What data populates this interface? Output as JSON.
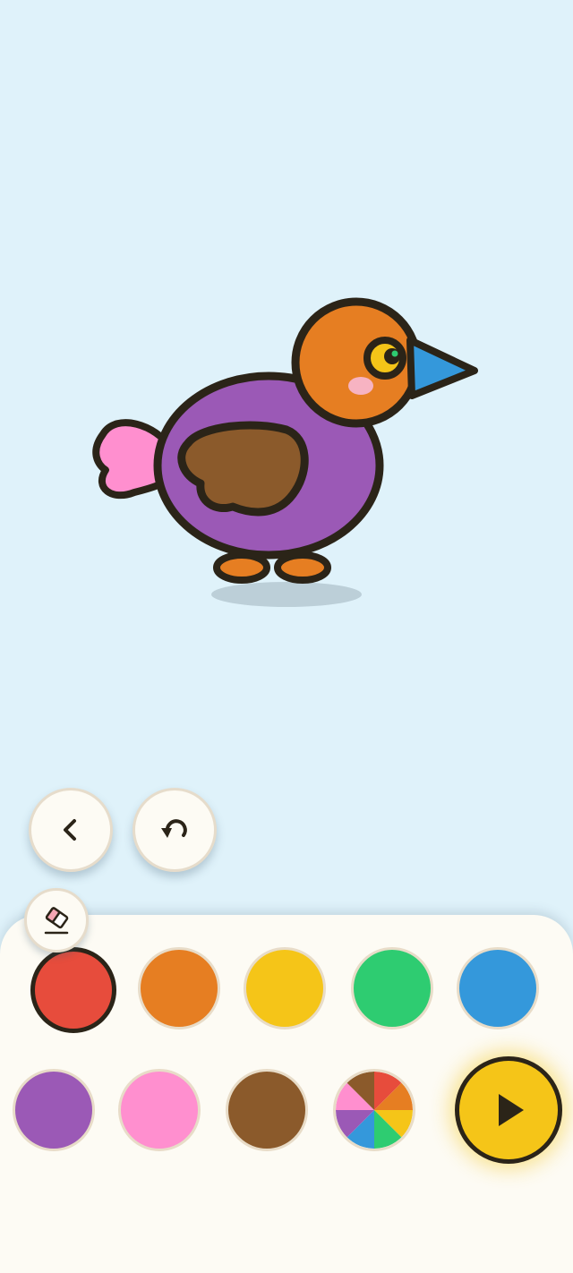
{
  "app": {
    "screen": "coloring-canvas"
  },
  "drawing": {
    "subject": "bird",
    "fills": {
      "body": "#9b59b6",
      "head": "#e67e22",
      "wing": "#8b5a2b",
      "tail": "#ff8fcf",
      "beak": "#3498db",
      "feet": "#e67e22",
      "eye": "#f5c518",
      "cheek": "#f7b3c2",
      "outline": "#2b2418",
      "shadow": "#bccfd8"
    }
  },
  "toolbar": {
    "back_icon": "chevron-left-icon",
    "undo_icon": "undo-icon",
    "eraser_icon": "eraser-icon"
  },
  "palette": {
    "selected_index": 0,
    "colors": [
      {
        "name": "red",
        "hex": "#e74c3c"
      },
      {
        "name": "orange",
        "hex": "#e67e22"
      },
      {
        "name": "yellow",
        "hex": "#f5c518"
      },
      {
        "name": "green",
        "hex": "#2ecc71"
      },
      {
        "name": "blue",
        "hex": "#3498db"
      },
      {
        "name": "purple",
        "hex": "#9b59b6"
      },
      {
        "name": "pink",
        "hex": "#ff8fcf"
      },
      {
        "name": "brown",
        "hex": "#8b5a2b"
      },
      {
        "name": "rainbow",
        "hex": "multi"
      }
    ],
    "play_icon": "play-icon"
  },
  "colors": {
    "background": "#dff2fa",
    "panel": "#fdfbf4",
    "accent": "#f5c518"
  }
}
